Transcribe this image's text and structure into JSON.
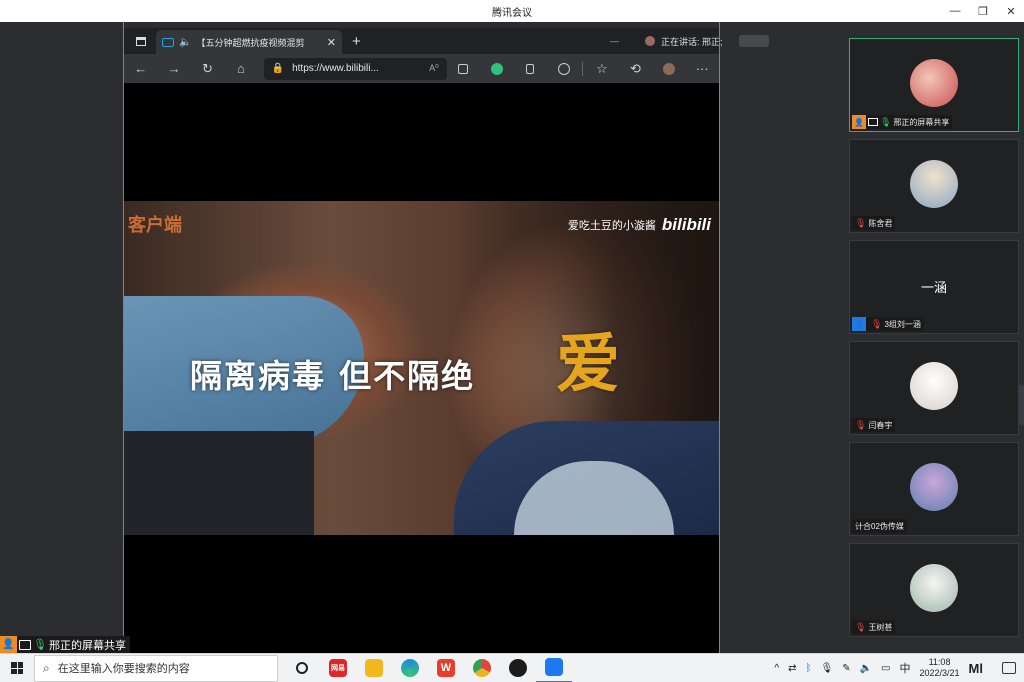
{
  "window": {
    "title": "腾讯会议",
    "controls": [
      "—",
      "❐",
      "✕"
    ]
  },
  "browser": {
    "tab_title": "【五分钟超燃抗疫视频混剪",
    "tab_close": "✕",
    "new_tab": "+",
    "url": "https://www.bilibili...",
    "reader_icon": "A⁰",
    "menu": "···"
  },
  "speaking": {
    "dash": "—",
    "label": "正在讲话: 邢正;"
  },
  "video": {
    "watermark_left": "客户端",
    "uploader": "爱吃土豆的小漩酱",
    "brand": "bilibili",
    "caption_main": "隔离病毒  但不隔绝",
    "caption_accent": "爱"
  },
  "share_label": "邢正的屏幕共享",
  "participants": [
    {
      "name": "邢正的屏幕共享",
      "avatar_color": "#c94f4f",
      "active": true,
      "host": true,
      "screen": true,
      "mic": "on"
    },
    {
      "name": "陈舍君",
      "avatar_color": "#8aa6c9",
      "mic": "off"
    },
    {
      "name": "3组刘一涵",
      "display_text": "一涵",
      "user_badge": true,
      "mic": "off"
    },
    {
      "name": "闫春宇",
      "avatar_color": "#e9e2dc",
      "mic": "off"
    },
    {
      "name": "计合02伪传媒",
      "avatar_color": "#7f8fb8"
    },
    {
      "name": "王树甚",
      "avatar_color": "#d9dfe0",
      "mic": "off"
    }
  ],
  "taskbar": {
    "search_placeholder": "在这里输入你要搜索的内容",
    "apps": [
      {
        "name": "cortana"
      },
      {
        "name": "netease",
        "label": "网易",
        "color": "#e0252b"
      },
      {
        "name": "file-explorer",
        "color": "#f2b81d"
      },
      {
        "name": "edge",
        "color": "#1f8fd6"
      },
      {
        "name": "wps",
        "label": "W",
        "color": "#e93c2c"
      },
      {
        "name": "chrome",
        "color": "#e8b51e"
      },
      {
        "name": "github",
        "color": "#1b1b1b"
      },
      {
        "name": "tencent-meeting",
        "color": "#1e79f0",
        "active": true
      }
    ],
    "tray": {
      "chevron": "^",
      "ime": "中",
      "time": "11:08",
      "date": "2022/3/21",
      "mi": "Ml"
    }
  }
}
